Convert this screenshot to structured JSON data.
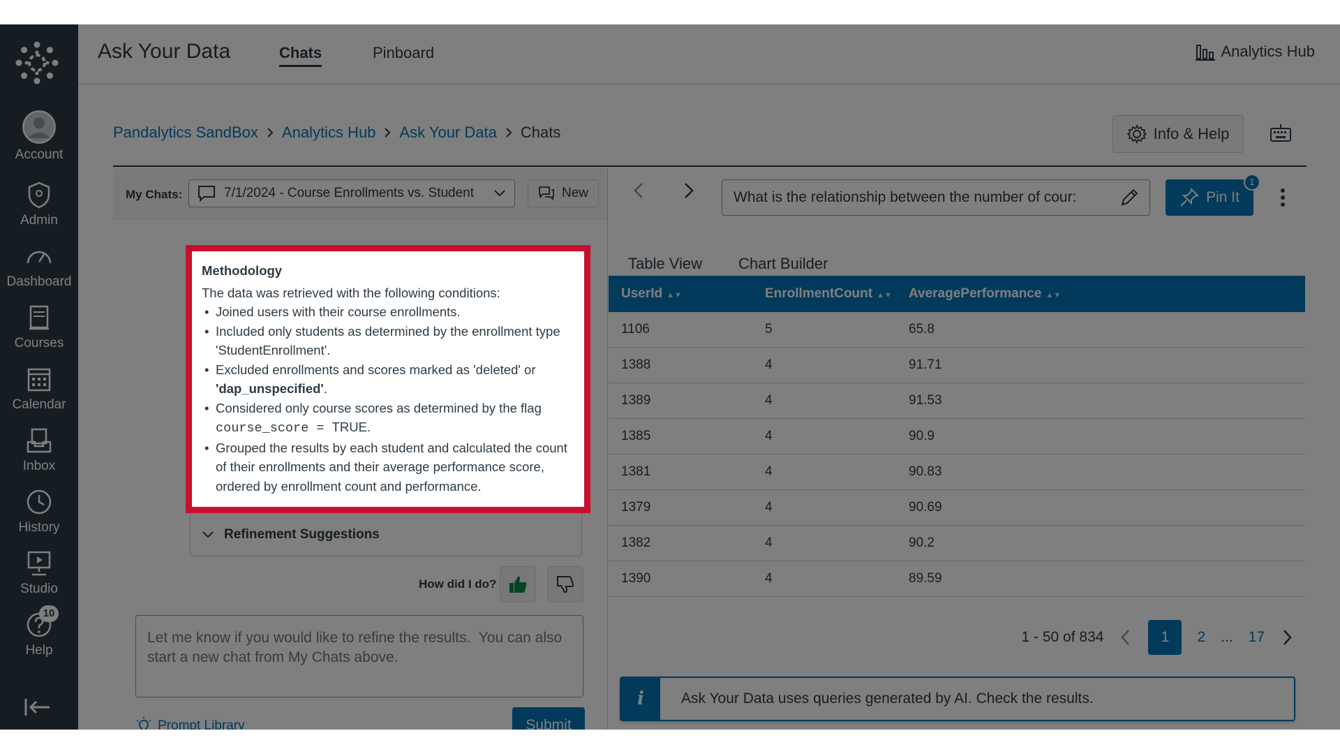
{
  "sidebar": {
    "items": [
      {
        "label": "Account",
        "icon": "account-icon"
      },
      {
        "label": "Admin",
        "icon": "shield-icon"
      },
      {
        "label": "Dashboard",
        "icon": "dashboard-icon"
      },
      {
        "label": "Courses",
        "icon": "courses-icon"
      },
      {
        "label": "Calendar",
        "icon": "calendar-icon"
      },
      {
        "label": "Inbox",
        "icon": "inbox-icon"
      },
      {
        "label": "History",
        "icon": "clock-icon"
      },
      {
        "label": "Studio",
        "icon": "studio-icon"
      },
      {
        "label": "Help",
        "icon": "help-icon",
        "badge": "10"
      }
    ]
  },
  "header": {
    "title": "Ask Your Data",
    "tabs": [
      {
        "label": "Chats",
        "active": true
      },
      {
        "label": "Pinboard",
        "active": false
      }
    ],
    "analytics_hub": "Analytics Hub"
  },
  "breadcrumb": {
    "items": [
      "Pandalytics SandBox",
      "Analytics Hub",
      "Ask Your Data"
    ],
    "current": "Chats"
  },
  "info_help": "Info & Help",
  "chats": {
    "label": "My Chats:",
    "selected": "7/1/2024 - Course Enrollments vs. Student",
    "new_label": "New"
  },
  "methodology": {
    "title": "Methodology",
    "intro": "The data was retrieved with the following conditions:",
    "b1": "Joined users with their course enrollments.",
    "b2": "Included only students as determined by the enrollment type 'StudentEnrollment'.",
    "b3_a": "Excluded enrollments and scores marked as 'deleted' or ",
    "b3_b": "'dap_unspecified'",
    "b3_c": ".",
    "b4_a": "Considered only course scores as determined by the flag ",
    "b4_code": "course_score = ",
    "b4_b": "TRUE.",
    "b5": "Grouped the results by each student and calculated the count of their enrollments and their average performance score, ordered by enrollment count and performance."
  },
  "refinement": "Refinement Suggestions",
  "feedback_label": "How did I do?",
  "chat_input_placeholder": "Let me know if you would like to refine the results.  You can also start a new chat from My Chats above.",
  "prompt_library": "Prompt Library",
  "submit": "Submit",
  "query": "What is the relationship between the number of cour:",
  "pin": {
    "label": "Pin It",
    "count": "1"
  },
  "view_tabs": [
    {
      "label": "Table View",
      "active": true
    },
    {
      "label": "Chart Builder",
      "active": false
    }
  ],
  "table": {
    "columns": [
      "UserId",
      "EnrollmentCount",
      "AveragePerformance"
    ],
    "rows": [
      [
        "1106",
        "5",
        "65.8"
      ],
      [
        "1388",
        "4",
        "91.71"
      ],
      [
        "1389",
        "4",
        "91.53"
      ],
      [
        "1385",
        "4",
        "90.9"
      ],
      [
        "1381",
        "4",
        "90.83"
      ],
      [
        "1379",
        "4",
        "90.69"
      ],
      [
        "1382",
        "4",
        "90.2"
      ],
      [
        "1390",
        "4",
        "89.59"
      ]
    ]
  },
  "pagination": {
    "summary": "1 - 50 of 834",
    "pages": [
      "1",
      "2",
      "...",
      "17"
    ],
    "current": "1"
  },
  "ai_notice": "Ask Your Data uses queries generated by AI. Check the results.",
  "colors": {
    "accent": "#0374b5",
    "sidebar": "#2d3b45",
    "highlight": "#c8102e",
    "thumbs_up": "#0b874b"
  }
}
